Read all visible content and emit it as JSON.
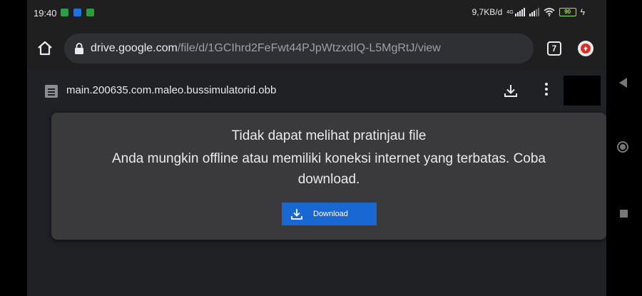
{
  "status_bar": {
    "time": "19:40",
    "network_speed": "9,7KB/d",
    "network_type": "4G",
    "battery": "90"
  },
  "browser": {
    "url_host": "drive.google.com",
    "url_path": "/file/d/1GCIhrd2FeFwt44PJpWtzxdIQ-L5MgRtJ/view",
    "tab_count": "7"
  },
  "file": {
    "name": "main.200635.com.maleo.bussimulatorid.obb"
  },
  "preview": {
    "title": "Tidak dapat melihat pratinjau file",
    "message": "Anda mungkin offline atau memiliki koneksi internet yang terbatas. Coba download.",
    "download_label": "Download"
  },
  "colors": {
    "accent": "#1967d2",
    "background": "#202124",
    "card": "#3a3a3c"
  },
  "icons": [
    "home-icon",
    "lock-icon",
    "tab-switcher-icon",
    "extension-icon",
    "file-icon",
    "download-icon",
    "more-vert-icon",
    "back-icon",
    "home-nav-icon",
    "recents-icon"
  ]
}
